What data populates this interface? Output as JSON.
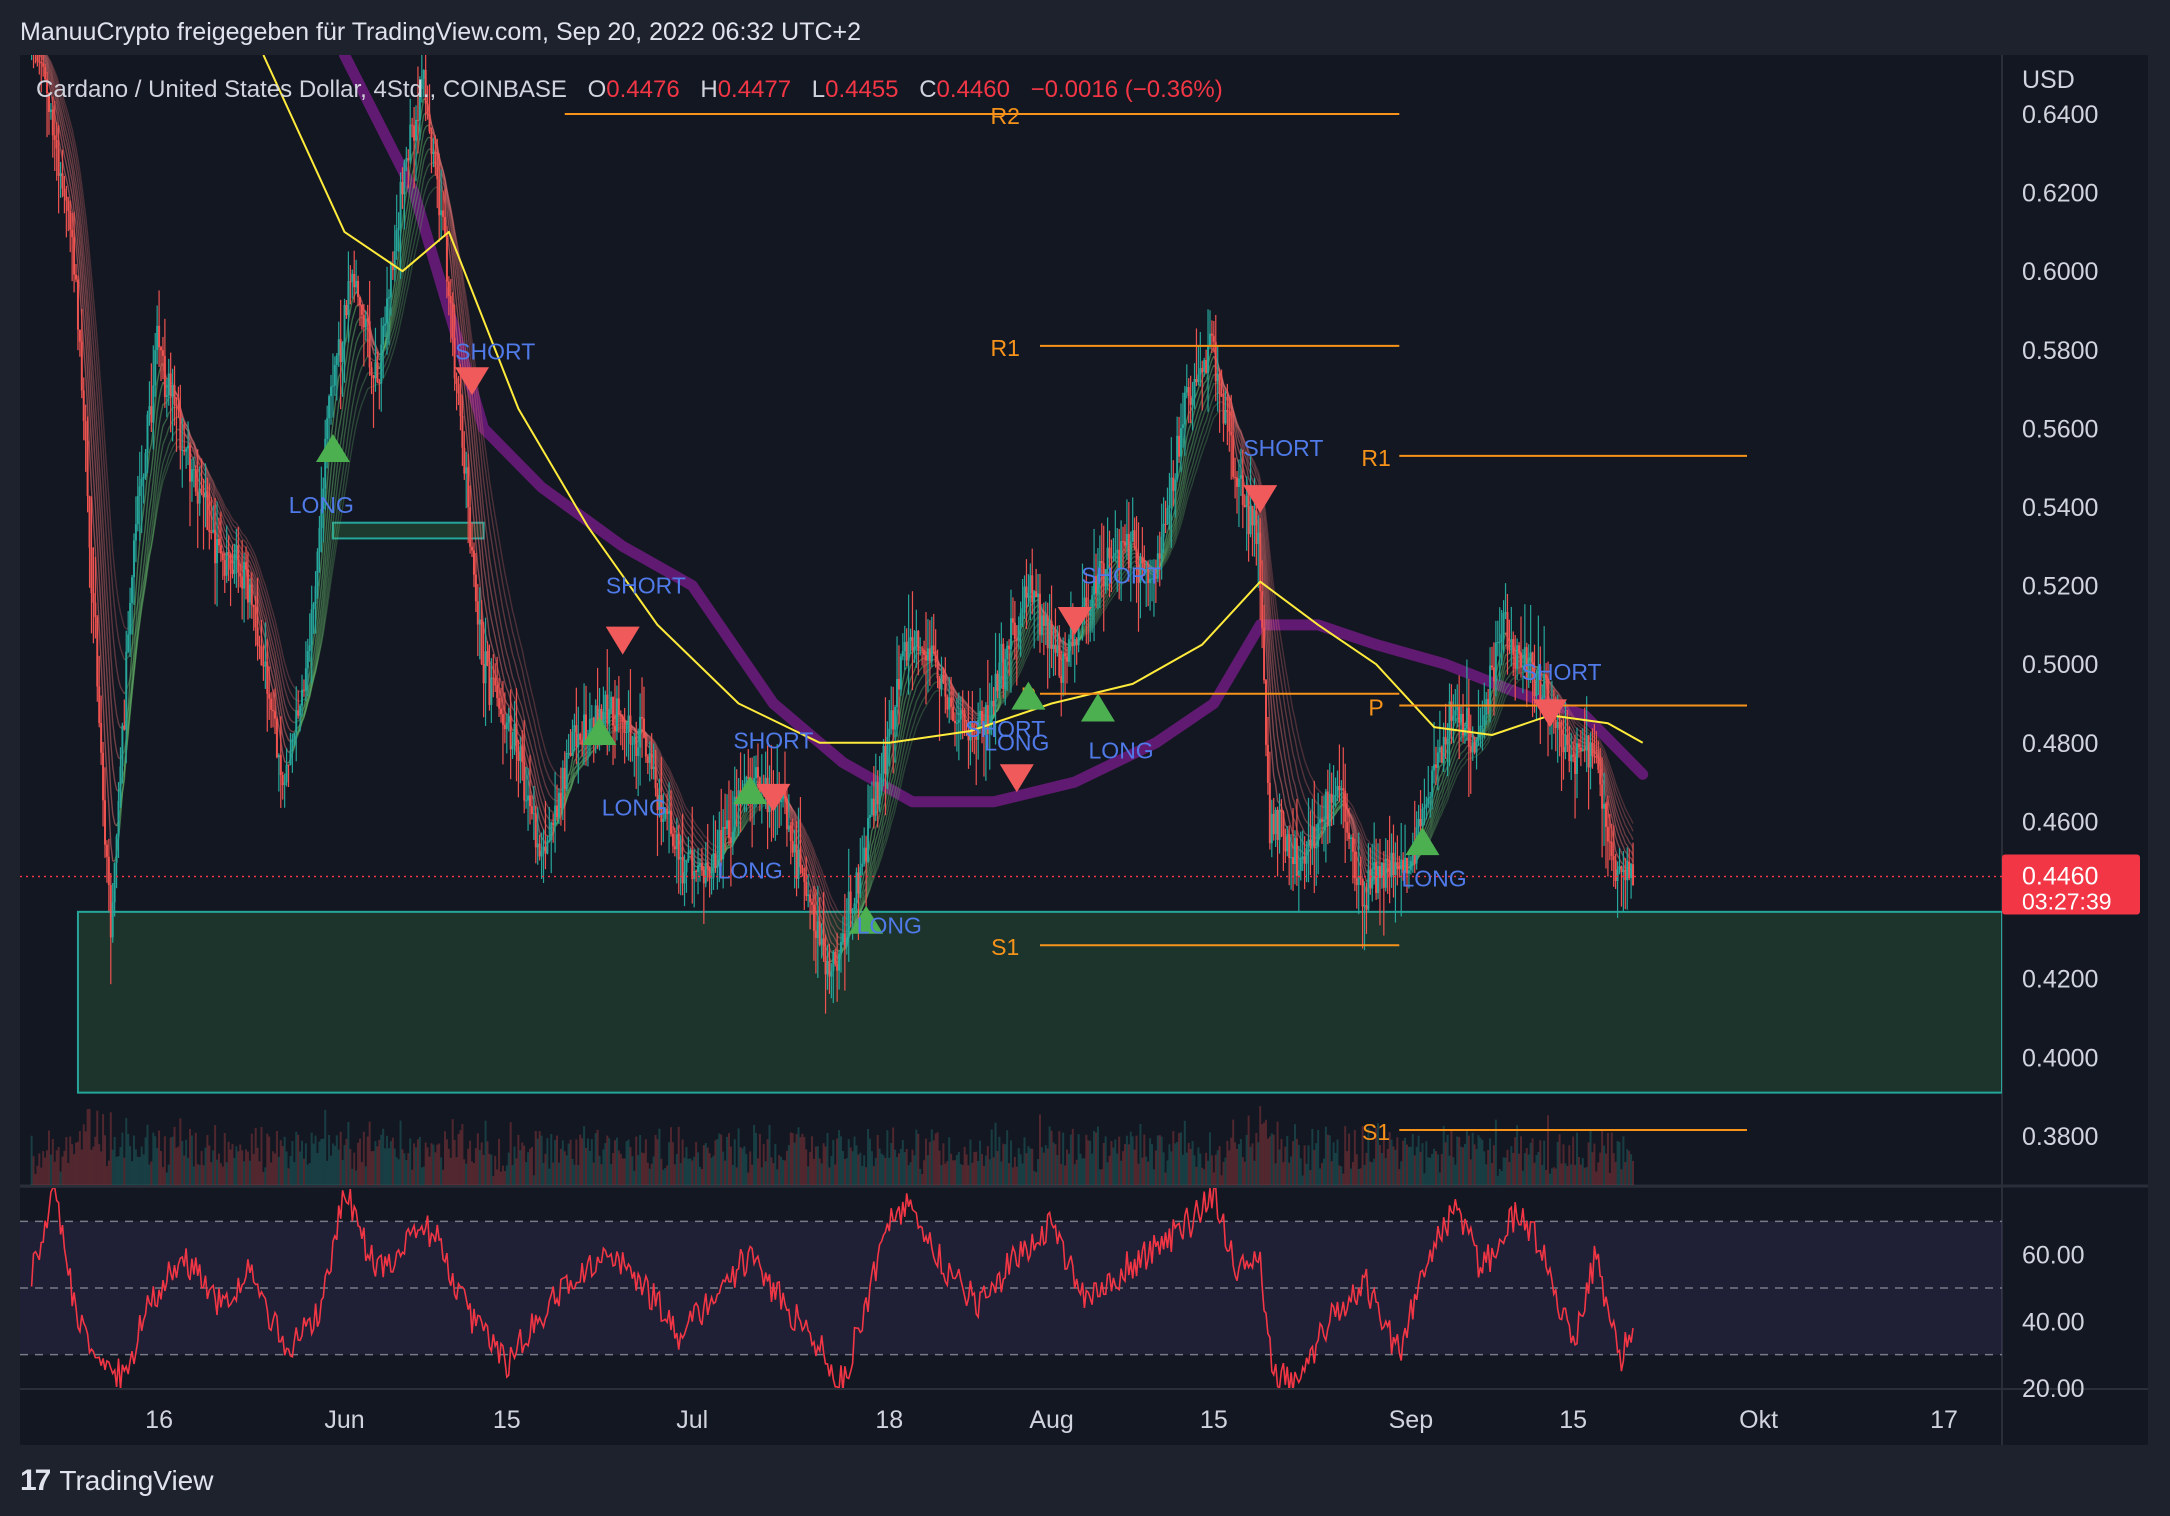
{
  "header": {
    "text": "ManuuCrypto freigegeben für TradingView.com, Sep 20, 2022 06:32 UTC+2"
  },
  "legend": {
    "symbol": "Cardano / United States Dollar, 4Std., COINBASE",
    "o_label": "O",
    "o_value": "0.4476",
    "h_label": "H",
    "h_value": "0.4477",
    "l_label": "L",
    "l_value": "0.4455",
    "c_label": "C",
    "c_value": "0.4460",
    "change": "−0.0016 (−0.36%)"
  },
  "footer": {
    "brand": "TradingView"
  },
  "colors": {
    "background": "#1e222d",
    "pane": "#131722",
    "grid": "#2a2e39",
    "up": "#26a69a",
    "down": "#ef5350",
    "long": "#4caf50",
    "short": "#f05a5a",
    "pivot": "#f7931a",
    "ema": "#ffeb3b",
    "ma": "#6a1b7a",
    "zone": "#1e3a2e",
    "zone_border": "#26a69a",
    "rsi": "#f23645",
    "signal_text": "#4f7ae8",
    "last_price": "#f23645"
  },
  "chart_data": [
    {
      "type": "candlestick",
      "currency": "USD",
      "price_axis": {
        "ticks": [
          "0.6400",
          "0.6200",
          "0.6000",
          "0.5800",
          "0.5600",
          "0.5400",
          "0.5200",
          "0.5000",
          "0.4800",
          "0.4600",
          "0.4400",
          "0.4200",
          "0.4000",
          "0.3800"
        ],
        "ylim": [
          0.3675,
          0.655
        ]
      },
      "time_axis": {
        "ticks": [
          {
            "label": "16",
            "date": "2022-05-16"
          },
          {
            "label": "Jun",
            "date": "2022-06-01"
          },
          {
            "label": "15",
            "date": "2022-06-15"
          },
          {
            "label": "Jul",
            "date": "2022-07-01"
          },
          {
            "label": "18",
            "date": "2022-07-18"
          },
          {
            "label": "Aug",
            "date": "2022-08-01"
          },
          {
            "label": "15",
            "date": "2022-08-15"
          },
          {
            "label": "Sep",
            "date": "2022-09-01"
          },
          {
            "label": "15",
            "date": "2022-09-15"
          },
          {
            "label": "Okt",
            "date": "2022-10-01"
          },
          {
            "label": "17",
            "date": "2022-10-17"
          }
        ],
        "xlim": [
          "2022-05-04",
          "2022-10-22"
        ]
      },
      "last_price": {
        "value": "0.4460",
        "countdown": "03:27:39"
      },
      "price_path": [
        {
          "date": "2022-05-06",
          "price": 0.655
        },
        {
          "date": "2022-05-09",
          "price": 0.6
        },
        {
          "date": "2022-05-12",
          "price": 0.43
        },
        {
          "date": "2022-05-14",
          "price": 0.53
        },
        {
          "date": "2022-05-16",
          "price": 0.58
        },
        {
          "date": "2022-05-19",
          "price": 0.55
        },
        {
          "date": "2022-05-21",
          "price": 0.53
        },
        {
          "date": "2022-05-24",
          "price": 0.52
        },
        {
          "date": "2022-05-27",
          "price": 0.47
        },
        {
          "date": "2022-05-29",
          "price": 0.5
        },
        {
          "date": "2022-05-31",
          "price": 0.57
        },
        {
          "date": "2022-06-02",
          "price": 0.6
        },
        {
          "date": "2022-06-04",
          "price": 0.57
        },
        {
          "date": "2022-06-06",
          "price": 0.62
        },
        {
          "date": "2022-06-08",
          "price": 0.65
        },
        {
          "date": "2022-06-10",
          "price": 0.6
        },
        {
          "date": "2022-06-13",
          "price": 0.5
        },
        {
          "date": "2022-06-16",
          "price": 0.48
        },
        {
          "date": "2022-06-18",
          "price": 0.45
        },
        {
          "date": "2022-06-21",
          "price": 0.48
        },
        {
          "date": "2022-06-24",
          "price": 0.49
        },
        {
          "date": "2022-06-27",
          "price": 0.48
        },
        {
          "date": "2022-06-30",
          "price": 0.45
        },
        {
          "date": "2022-07-03",
          "price": 0.45
        },
        {
          "date": "2022-07-06",
          "price": 0.47
        },
        {
          "date": "2022-07-09",
          "price": 0.465
        },
        {
          "date": "2022-07-11",
          "price": 0.44
        },
        {
          "date": "2022-07-13",
          "price": 0.42
        },
        {
          "date": "2022-07-15",
          "price": 0.44
        },
        {
          "date": "2022-07-18",
          "price": 0.48
        },
        {
          "date": "2022-07-20",
          "price": 0.51
        },
        {
          "date": "2022-07-22",
          "price": 0.5
        },
        {
          "date": "2022-07-25",
          "price": 0.48
        },
        {
          "date": "2022-07-27",
          "price": 0.49
        },
        {
          "date": "2022-07-30",
          "price": 0.52
        },
        {
          "date": "2022-08-02",
          "price": 0.5
        },
        {
          "date": "2022-08-05",
          "price": 0.52
        },
        {
          "date": "2022-08-08",
          "price": 0.53
        },
        {
          "date": "2022-08-10",
          "price": 0.52
        },
        {
          "date": "2022-08-13",
          "price": 0.57
        },
        {
          "date": "2022-08-15",
          "price": 0.58
        },
        {
          "date": "2022-08-17",
          "price": 0.55
        },
        {
          "date": "2022-08-19",
          "price": 0.53
        },
        {
          "date": "2022-08-20",
          "price": 0.46
        },
        {
          "date": "2022-08-23",
          "price": 0.45
        },
        {
          "date": "2022-08-26",
          "price": 0.47
        },
        {
          "date": "2022-08-28",
          "price": 0.44
        },
        {
          "date": "2022-08-30",
          "price": 0.45
        },
        {
          "date": "2022-09-01",
          "price": 0.45
        },
        {
          "date": "2022-09-03",
          "price": 0.47
        },
        {
          "date": "2022-09-05",
          "price": 0.49
        },
        {
          "date": "2022-09-07",
          "price": 0.48
        },
        {
          "date": "2022-09-09",
          "price": 0.51
        },
        {
          "date": "2022-09-11",
          "price": 0.5
        },
        {
          "date": "2022-09-13",
          "price": 0.49
        },
        {
          "date": "2022-09-15",
          "price": 0.475
        },
        {
          "date": "2022-09-17",
          "price": 0.48
        },
        {
          "date": "2022-09-19",
          "price": 0.445
        },
        {
          "date": "2022-09-20",
          "price": 0.446
        }
      ],
      "ema_path": [
        {
          "date": "2022-05-25",
          "price": 0.655
        },
        {
          "date": "2022-06-01",
          "price": 0.61
        },
        {
          "date": "2022-06-06",
          "price": 0.6
        },
        {
          "date": "2022-06-10",
          "price": 0.61
        },
        {
          "date": "2022-06-16",
          "price": 0.565
        },
        {
          "date": "2022-06-22",
          "price": 0.535
        },
        {
          "date": "2022-06-28",
          "price": 0.51
        },
        {
          "date": "2022-07-05",
          "price": 0.49
        },
        {
          "date": "2022-07-12",
          "price": 0.48
        },
        {
          "date": "2022-07-18",
          "price": 0.48
        },
        {
          "date": "2022-07-25",
          "price": 0.483
        },
        {
          "date": "2022-08-01",
          "price": 0.49
        },
        {
          "date": "2022-08-08",
          "price": 0.495
        },
        {
          "date": "2022-08-14",
          "price": 0.505
        },
        {
          "date": "2022-08-19",
          "price": 0.521
        },
        {
          "date": "2022-08-24",
          "price": 0.51
        },
        {
          "date": "2022-08-29",
          "price": 0.5
        },
        {
          "date": "2022-09-03",
          "price": 0.484
        },
        {
          "date": "2022-09-08",
          "price": 0.482
        },
        {
          "date": "2022-09-13",
          "price": 0.487
        },
        {
          "date": "2022-09-18",
          "price": 0.485
        },
        {
          "date": "2022-09-21",
          "price": 0.48
        }
      ],
      "ma_path": [
        {
          "date": "2022-06-01",
          "price": 0.655
        },
        {
          "date": "2022-06-07",
          "price": 0.62
        },
        {
          "date": "2022-06-13",
          "price": 0.56
        },
        {
          "date": "2022-06-18",
          "price": 0.545
        },
        {
          "date": "2022-06-25",
          "price": 0.53
        },
        {
          "date": "2022-07-01",
          "price": 0.52
        },
        {
          "date": "2022-07-08",
          "price": 0.49
        },
        {
          "date": "2022-07-14",
          "price": 0.475
        },
        {
          "date": "2022-07-20",
          "price": 0.465
        },
        {
          "date": "2022-07-27",
          "price": 0.465
        },
        {
          "date": "2022-08-03",
          "price": 0.47
        },
        {
          "date": "2022-08-10",
          "price": 0.48
        },
        {
          "date": "2022-08-15",
          "price": 0.49
        },
        {
          "date": "2022-08-19",
          "price": 0.51
        },
        {
          "date": "2022-08-24",
          "price": 0.51
        },
        {
          "date": "2022-08-29",
          "price": 0.505
        },
        {
          "date": "2022-09-04",
          "price": 0.5
        },
        {
          "date": "2022-09-10",
          "price": 0.493
        },
        {
          "date": "2022-09-16",
          "price": 0.487
        },
        {
          "date": "2022-09-21",
          "price": 0.472
        }
      ],
      "demand_zone": {
        "x_from": "2022-05-09",
        "price_from": 0.391,
        "price_to": 0.437
      },
      "pivot_levels": [
        {
          "label": "R2",
          "price": 0.64,
          "from": "2022-06-20",
          "to": "2022-08-31",
          "label_date": "2022-07-28"
        },
        {
          "label": "R1",
          "price": 0.581,
          "from": "2022-07-31",
          "to": "2022-08-31",
          "label_date": "2022-07-28"
        },
        {
          "label": "P",
          "price": 0.4925,
          "from": "2022-07-31",
          "to": "2022-08-31",
          "label_date": "2022-07-30"
        },
        {
          "label": "S1",
          "price": 0.4285,
          "from": "2022-07-31",
          "to": "2022-08-31",
          "label_date": "2022-07-28"
        },
        {
          "label": "R1",
          "price": 0.553,
          "from": "2022-08-31",
          "to": "2022-09-30",
          "label_date": "2022-08-29"
        },
        {
          "label": "P",
          "price": 0.4895,
          "from": "2022-08-31",
          "to": "2022-09-30",
          "label_date": "2022-08-29"
        },
        {
          "label": "S1",
          "price": 0.3815,
          "from": "2022-08-31",
          "to": "2022-09-30",
          "label_date": "2022-08-29"
        }
      ],
      "signals": [
        {
          "type": "long",
          "label": "LONG",
          "date": "2022-05-31",
          "price": 0.555
        },
        {
          "type": "short",
          "label": "SHORT",
          "date": "2022-06-12",
          "price": 0.572
        },
        {
          "type": "short",
          "label": "SHORT",
          "date": "2022-06-25",
          "price": 0.506
        },
        {
          "type": "long",
          "label": "LONG",
          "date": "2022-06-23",
          "price": 0.483
        },
        {
          "type": "long",
          "label": "LONG",
          "date": "2022-07-06",
          "price": 0.468
        },
        {
          "type": "short",
          "label": "SHORT",
          "date": "2022-07-08",
          "price": 0.466
        },
        {
          "type": "long",
          "label": "LONG",
          "date": "2022-07-16",
          "price": 0.435
        },
        {
          "type": "long",
          "label": "LONG",
          "date": "2022-07-30",
          "price": 0.492
        },
        {
          "type": "short",
          "label": "SHORT",
          "date": "2022-07-29",
          "price": 0.471
        },
        {
          "type": "short",
          "label": "SHORT",
          "date": "2022-08-03",
          "price": 0.511
        },
        {
          "type": "long",
          "label": "LONG",
          "date": "2022-08-05",
          "price": 0.489
        },
        {
          "type": "short",
          "label": "SHORT",
          "date": "2022-08-19",
          "price": 0.542
        },
        {
          "type": "long",
          "label": "LONG",
          "date": "2022-09-02",
          "price": 0.455
        },
        {
          "type": "short",
          "label": "SHORT",
          "date": "2022-09-13",
          "price": 0.4875
        }
      ],
      "signal_label_positions": [
        {
          "label": "LONG",
          "date": "2022-05-30",
          "price": 0.5385
        },
        {
          "label": "SHORT",
          "date": "2022-06-14",
          "price": 0.5775
        },
        {
          "label": "SHORT",
          "date": "2022-06-27",
          "price": 0.518
        },
        {
          "label": "LONG",
          "date": "2022-06-26",
          "price": 0.4615
        },
        {
          "label": "SHORT",
          "date": "2022-07-08",
          "price": 0.4785
        },
        {
          "label": "LONG",
          "date": "2022-07-06",
          "price": 0.4455
        },
        {
          "label": "LONG",
          "date": "2022-07-18",
          "price": 0.4315
        },
        {
          "label": "SHORT",
          "date": "2022-07-28",
          "price": 0.4815
        },
        {
          "label": "LONG",
          "date": "2022-07-29",
          "price": 0.478
        },
        {
          "label": "SHORT",
          "date": "2022-08-07",
          "price": 0.5205
        },
        {
          "label": "LONG",
          "date": "2022-08-07",
          "price": 0.476
        },
        {
          "label": "SHORT",
          "date": "2022-08-21",
          "price": 0.553
        },
        {
          "label": "LONG",
          "date": "2022-09-03",
          "price": 0.4435
        },
        {
          "label": "SHORT",
          "date": "2022-09-14",
          "price": 0.496
        }
      ]
    },
    {
      "type": "line",
      "indicator": "RSI",
      "y_ticks": [
        "60.00",
        "40.00",
        "20.00"
      ],
      "ylim": [
        20,
        80
      ],
      "bands": [
        70,
        50,
        30
      ],
      "values_path": [
        {
          "date": "2022-05-05",
          "value": 55
        },
        {
          "date": "2022-05-07",
          "value": 78
        },
        {
          "date": "2022-05-09",
          "value": 40
        },
        {
          "date": "2022-05-11",
          "value": 30
        },
        {
          "date": "2022-05-13",
          "value": 22
        },
        {
          "date": "2022-05-15",
          "value": 45
        },
        {
          "date": "2022-05-18",
          "value": 60
        },
        {
          "date": "2022-05-21",
          "value": 45
        },
        {
          "date": "2022-05-24",
          "value": 55
        },
        {
          "date": "2022-05-27",
          "value": 30
        },
        {
          "date": "2022-05-30",
          "value": 45
        },
        {
          "date": "2022-06-01",
          "value": 80
        },
        {
          "date": "2022-06-03",
          "value": 60
        },
        {
          "date": "2022-06-05",
          "value": 55
        },
        {
          "date": "2022-06-07",
          "value": 70
        },
        {
          "date": "2022-06-09",
          "value": 65
        },
        {
          "date": "2022-06-12",
          "value": 40
        },
        {
          "date": "2022-06-15",
          "value": 28
        },
        {
          "date": "2022-06-18",
          "value": 42
        },
        {
          "date": "2022-06-21",
          "value": 55
        },
        {
          "date": "2022-06-24",
          "value": 62
        },
        {
          "date": "2022-06-27",
          "value": 50
        },
        {
          "date": "2022-06-30",
          "value": 35
        },
        {
          "date": "2022-07-03",
          "value": 48
        },
        {
          "date": "2022-07-06",
          "value": 60
        },
        {
          "date": "2022-07-09",
          "value": 45
        },
        {
          "date": "2022-07-12",
          "value": 32
        },
        {
          "date": "2022-07-14",
          "value": 22
        },
        {
          "date": "2022-07-16",
          "value": 45
        },
        {
          "date": "2022-07-18",
          "value": 70
        },
        {
          "date": "2022-07-20",
          "value": 75
        },
        {
          "date": "2022-07-23",
          "value": 55
        },
        {
          "date": "2022-07-26",
          "value": 45
        },
        {
          "date": "2022-07-29",
          "value": 60
        },
        {
          "date": "2022-08-01",
          "value": 70
        },
        {
          "date": "2022-08-04",
          "value": 45
        },
        {
          "date": "2022-08-07",
          "value": 55
        },
        {
          "date": "2022-08-10",
          "value": 62
        },
        {
          "date": "2022-08-13",
          "value": 70
        },
        {
          "date": "2022-08-15",
          "value": 78
        },
        {
          "date": "2022-08-17",
          "value": 55
        },
        {
          "date": "2022-08-19",
          "value": 58
        },
        {
          "date": "2022-08-20",
          "value": 25
        },
        {
          "date": "2022-08-22",
          "value": 20
        },
        {
          "date": "2022-08-25",
          "value": 40
        },
        {
          "date": "2022-08-28",
          "value": 52
        },
        {
          "date": "2022-08-31",
          "value": 30
        },
        {
          "date": "2022-09-02",
          "value": 55
        },
        {
          "date": "2022-09-05",
          "value": 75
        },
        {
          "date": "2022-09-07",
          "value": 55
        },
        {
          "date": "2022-09-10",
          "value": 72
        },
        {
          "date": "2022-09-12",
          "value": 65
        },
        {
          "date": "2022-09-13",
          "value": 52
        },
        {
          "date": "2022-09-15",
          "value": 33
        },
        {
          "date": "2022-09-17",
          "value": 60
        },
        {
          "date": "2022-09-19",
          "value": 28
        },
        {
          "date": "2022-09-20",
          "value": 38
        }
      ]
    }
  ]
}
